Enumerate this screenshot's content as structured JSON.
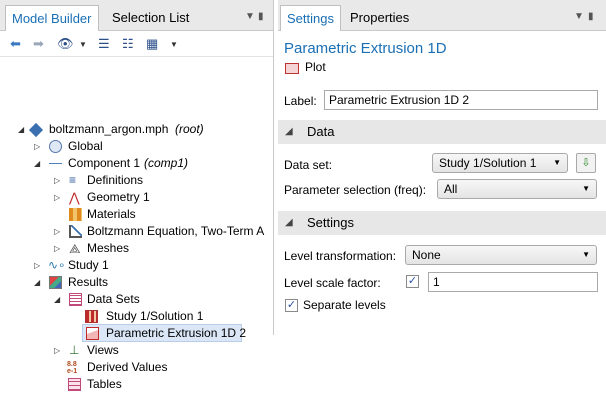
{
  "left_panel": {
    "tabs": [
      "Model Builder",
      "Selection List"
    ],
    "tree": [
      {
        "label": "boltzmann_argon.mph",
        "suffix": "(root)"
      },
      {
        "label": "Global"
      },
      {
        "label": "Component 1",
        "suffix": "(comp1)"
      },
      {
        "label": "Definitions"
      },
      {
        "label": "Geometry 1"
      },
      {
        "label": "Materials"
      },
      {
        "label": "Boltzmann Equation, Two-Term A"
      },
      {
        "label": "Meshes"
      },
      {
        "label": "Study 1"
      },
      {
        "label": "Results"
      },
      {
        "label": "Data Sets"
      },
      {
        "label": "Study 1/Solution 1"
      },
      {
        "label": "Parametric Extrusion 1D 2"
      },
      {
        "label": "Views"
      },
      {
        "label": "Derived Values"
      },
      {
        "label": "Tables"
      }
    ]
  },
  "right_panel": {
    "tabs": [
      "Settings",
      "Properties"
    ],
    "title": "Parametric Extrusion 1D",
    "plot_label": "Plot",
    "label_field": {
      "label": "Label:",
      "value": "Parametric Extrusion 1D 2"
    },
    "data_section": {
      "title": "Data",
      "data_set": {
        "label": "Data set:",
        "value": "Study 1/Solution 1"
      },
      "param_selection": {
        "label": "Parameter selection (freq):",
        "value": "All"
      }
    },
    "settings_section": {
      "title": "Settings",
      "level_transformation": {
        "label": "Level transformation:",
        "value": "None"
      },
      "level_scale": {
        "label": "Level scale factor:",
        "value": "1",
        "checked": true
      },
      "separate_levels": {
        "label": "Separate levels",
        "checked": true
      }
    }
  },
  "colors": {
    "accent": "#1a6fb5",
    "selection": "#dbe7f7",
    "section_bg": "#e7e7e7"
  }
}
